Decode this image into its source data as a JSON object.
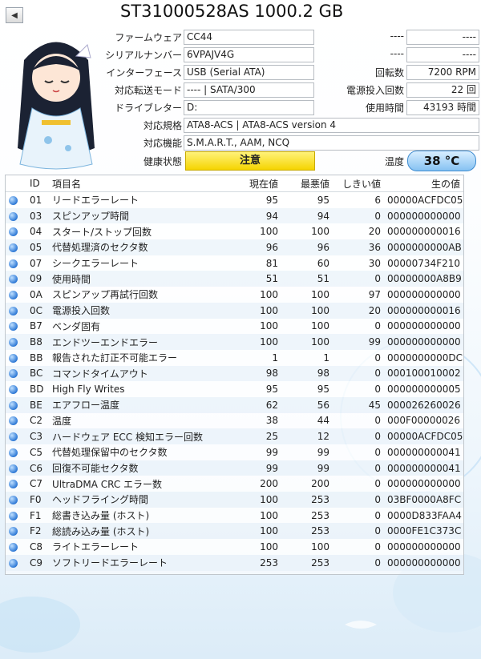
{
  "header": {
    "title": "ST31000528AS 1000.2 GB",
    "back_icon": "triangle-left-icon"
  },
  "info": {
    "firmware": {
      "label": "ファームウェア",
      "value": "CC44"
    },
    "serial": {
      "label": "シリアルナンバー",
      "value": "6VPAJV4G"
    },
    "interface": {
      "label": "インターフェース",
      "value": "USB (Serial ATA)"
    },
    "transfer": {
      "label": "対応転送モード",
      "value": "---- | SATA/300"
    },
    "drive_letter": {
      "label": "ドライブレター",
      "value": "D:"
    },
    "standard": {
      "label": "対応規格",
      "value": "ATA8-ACS | ATA8-ACS version 4"
    },
    "features": {
      "label": "対応機能",
      "value": "S.M.A.R.T., AAM, NCQ"
    },
    "right_top1": {
      "label": "----",
      "value": "----"
    },
    "right_top2": {
      "label": "----",
      "value": "----"
    },
    "rotation": {
      "label": "回転数",
      "value": "7200 RPM"
    },
    "power_count": {
      "label": "電源投入回数",
      "value": "22 回"
    },
    "power_hours": {
      "label": "使用時間",
      "value": "43193 時間"
    }
  },
  "health": {
    "label": "健康状態",
    "value": "注意",
    "color": "#f5d400"
  },
  "temperature": {
    "label": "温度",
    "value": "38 °C",
    "color": "#86c2f2"
  },
  "table": {
    "headers": [
      "",
      "ID",
      "項目名",
      "現在値",
      "最悪値",
      "しきい値",
      "生の値"
    ],
    "rows": [
      [
        "01",
        "リードエラーレート",
        "95",
        "95",
        "6",
        "00000ACFDC05"
      ],
      [
        "03",
        "スピンアップ時間",
        "94",
        "94",
        "0",
        "000000000000"
      ],
      [
        "04",
        "スタート/ストップ回数",
        "100",
        "100",
        "20",
        "000000000016"
      ],
      [
        "05",
        "代替処理済のセクタ数",
        "96",
        "96",
        "36",
        "0000000000AB"
      ],
      [
        "07",
        "シークエラーレート",
        "81",
        "60",
        "30",
        "00000734F210"
      ],
      [
        "09",
        "使用時間",
        "51",
        "51",
        "0",
        "00000000A8B9"
      ],
      [
        "0A",
        "スピンアップ再試行回数",
        "100",
        "100",
        "97",
        "000000000000"
      ],
      [
        "0C",
        "電源投入回数",
        "100",
        "100",
        "20",
        "000000000016"
      ],
      [
        "B7",
        "ベンダ固有",
        "100",
        "100",
        "0",
        "000000000000"
      ],
      [
        "B8",
        "エンドツーエンドエラー",
        "100",
        "100",
        "99",
        "000000000000"
      ],
      [
        "BB",
        "報告された訂正不可能エラー",
        "1",
        "1",
        "0",
        "0000000000DC"
      ],
      [
        "BC",
        "コマンドタイムアウト",
        "98",
        "98",
        "0",
        "000100010002"
      ],
      [
        "BD",
        "High Fly Writes",
        "95",
        "95",
        "0",
        "000000000005"
      ],
      [
        "BE",
        "エアフロー温度",
        "62",
        "56",
        "45",
        "000026260026"
      ],
      [
        "C2",
        "温度",
        "38",
        "44",
        "0",
        "000F00000026"
      ],
      [
        "C3",
        "ハードウェア ECC 検知エラー回数",
        "25",
        "12",
        "0",
        "00000ACFDC05"
      ],
      [
        "C5",
        "代替処理保留中のセクタ数",
        "99",
        "99",
        "0",
        "000000000041"
      ],
      [
        "C6",
        "回復不可能セクタ数",
        "99",
        "99",
        "0",
        "000000000041"
      ],
      [
        "C7",
        "UltraDMA CRC エラー数",
        "200",
        "200",
        "0",
        "000000000000"
      ],
      [
        "F0",
        "ヘッドフライング時間",
        "100",
        "253",
        "0",
        "03BF0000A8FC"
      ],
      [
        "F1",
        "総書き込み量 (ホスト)",
        "100",
        "253",
        "0",
        "0000D833FAA4"
      ],
      [
        "F2",
        "総読み込み量 (ホスト)",
        "100",
        "253",
        "0",
        "0000FE1C373C"
      ],
      [
        "C8",
        "ライトエラーレート",
        "100",
        "100",
        "0",
        "000000000000"
      ],
      [
        "C9",
        "ソフトリードエラーレート",
        "253",
        "253",
        "0",
        "000000000000"
      ]
    ]
  }
}
